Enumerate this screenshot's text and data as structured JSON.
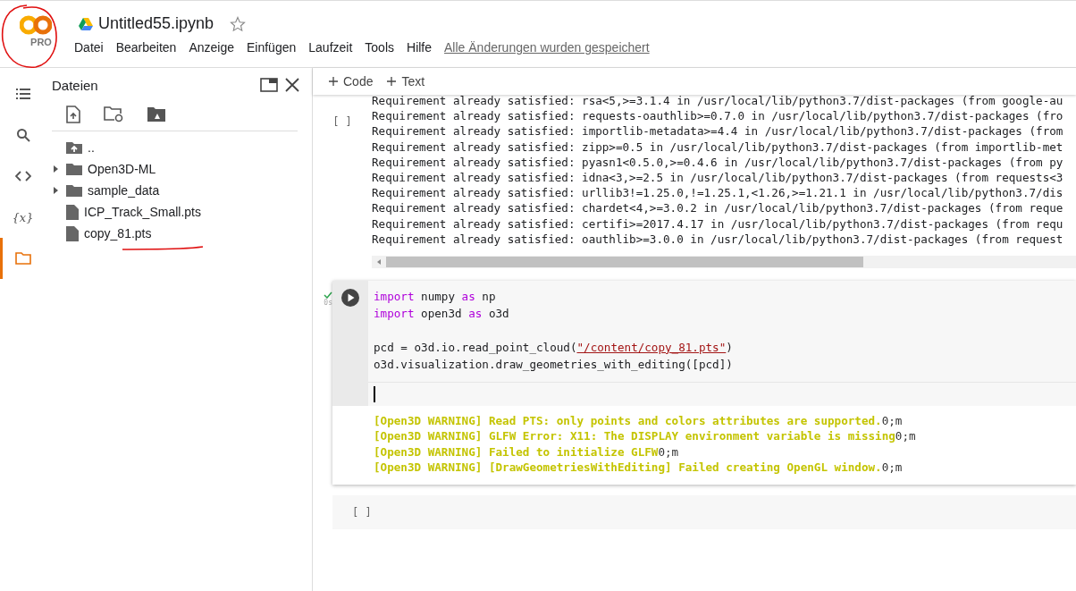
{
  "header": {
    "logo_badge": "PRO",
    "title": "Untitled55.ipynb",
    "starred": false,
    "menu": [
      "Datei",
      "Bearbeiten",
      "Anzeige",
      "Einfügen",
      "Laufzeit",
      "Tools",
      "Hilfe"
    ],
    "save_status": "Alle Änderungen wurden gespeichert"
  },
  "rail": [
    {
      "kind": "toc",
      "selected": false
    },
    {
      "kind": "search",
      "selected": false
    },
    {
      "kind": "code",
      "selected": false
    },
    {
      "kind": "variables",
      "label": "{x}",
      "selected": false
    },
    {
      "kind": "files",
      "selected": true
    }
  ],
  "files_panel": {
    "title": "Dateien",
    "items": [
      {
        "kind": "parent",
        "name": ".."
      },
      {
        "kind": "folder",
        "name": "Open3D-ML",
        "expanded": false
      },
      {
        "kind": "folder",
        "name": "sample_data",
        "expanded": false
      },
      {
        "kind": "file",
        "name": "ICP_Track_Small.pts"
      },
      {
        "kind": "file",
        "name": "copy_81.pts"
      }
    ]
  },
  "toolbar": [
    "Code",
    "Text"
  ],
  "cells": [
    {
      "kind": "output_only",
      "prompt": "[ ]",
      "output": [
        {
          "text": "Requirement already satisfied: rsa<5,>=3.1.4 in /usr/local/lib/python3.7/dist-packages (from google-au"
        },
        {
          "text": "Requirement already satisfied: requests-oauthlib>=0.7.0 in /usr/local/lib/python3.7/dist-packages (fro"
        },
        {
          "text": "Requirement already satisfied: importlib-metadata>=4.4 in /usr/local/lib/python3.7/dist-packages (from"
        },
        {
          "text": "Requirement already satisfied: zipp>=0.5 in /usr/local/lib/python3.7/dist-packages (from importlib-met"
        },
        {
          "text": "Requirement already satisfied: pyasn1<0.5.0,>=0.4.6 in /usr/local/lib/python3.7/dist-packages (from py"
        },
        {
          "text": "Requirement already satisfied: idna<3,>=2.5 in /usr/local/lib/python3.7/dist-packages (from requests<3"
        },
        {
          "text": "Requirement already satisfied: urllib3!=1.25.0,!=1.25.1,<1.26,>=1.21.1 in /usr/local/lib/python3.7/dis"
        },
        {
          "text": "Requirement already satisfied: chardet<4,>=3.0.2 in /usr/local/lib/python3.7/dist-packages (from reque"
        },
        {
          "text": "Requirement already satisfied: certifi>=2017.4.17 in /usr/local/lib/python3.7/dist-packages (from requ"
        },
        {
          "text": "Requirement already satisfied: oauthlib>=3.0.0 in /usr/local/lib/python3.7/dist-packages (from request"
        }
      ],
      "scrollbar": true
    },
    {
      "kind": "code",
      "focused": true,
      "status": {
        "done": true,
        "time": "0s"
      },
      "code": [
        {
          "kind": "code",
          "tokens": [
            {
              "kind": "keyword",
              "s": "import"
            },
            {
              "kind": "plain",
              "s": " numpy "
            },
            {
              "kind": "keyword",
              "s": "as"
            },
            {
              "kind": "plain",
              "s": " np"
            }
          ]
        },
        {
          "kind": "code",
          "tokens": [
            {
              "kind": "keyword",
              "s": "import"
            },
            {
              "kind": "plain",
              "s": " open3d "
            },
            {
              "kind": "keyword",
              "s": "as"
            },
            {
              "kind": "plain",
              "s": " o3d"
            }
          ]
        },
        {
          "kind": "blank"
        },
        {
          "kind": "code",
          "tokens": [
            {
              "kind": "plain",
              "s": "pcd = o3d.io.read_point_cloud("
            },
            {
              "kind": "string",
              "s": "\"/content/copy_81.pts\""
            },
            {
              "kind": "plain",
              "s": ")"
            }
          ]
        },
        {
          "kind": "code",
          "tokens": [
            {
              "kind": "plain",
              "s": "o3d.visualization.draw_geometries_with_editing([pcd])"
            }
          ]
        }
      ],
      "output": [
        {
          "text": "[Open3D WARNING] Read PTS: only points and colors attributes are supported.",
          "suffix": "0;m"
        },
        {
          "text": "[Open3D WARNING] GLFW Error: X11: The DISPLAY environment variable is missing",
          "suffix": "0;m"
        },
        {
          "text": "[Open3D WARNING] Failed to initialize GLFW",
          "suffix": "0;m"
        },
        {
          "text": "[Open3D WARNING] [DrawGeometriesWithEditing] Failed creating OpenGL window.",
          "suffix": "0;m"
        }
      ]
    },
    {
      "kind": "empty",
      "prompt": "[ ]"
    }
  ]
}
